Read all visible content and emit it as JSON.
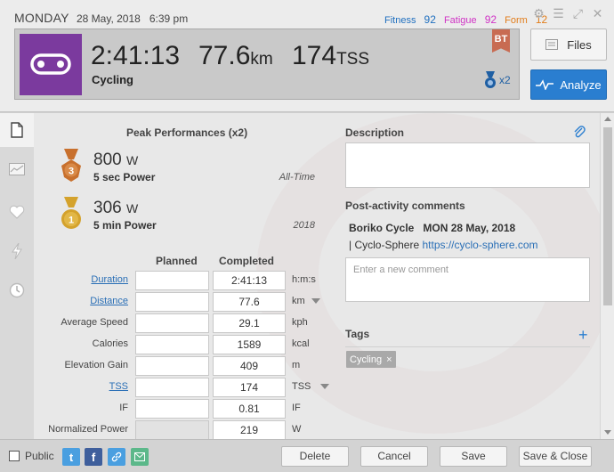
{
  "header": {
    "day": "MONDAY",
    "date": "28 May, 2018",
    "time": "6:39 pm",
    "fitness_label": "Fitness",
    "fitness_value": "92",
    "fatigue_label": "Fatigue",
    "fatigue_value": "92",
    "form_label": "Form",
    "form_value": "12",
    "window_icons": [
      "gear-icon",
      "menu-icon",
      "expand-icon",
      "close-icon"
    ]
  },
  "summary": {
    "sport_icon": "chain-link-icon",
    "sport_color": "#7b3a9e",
    "duration": "2:41:13",
    "distance_value": "77.6",
    "distance_unit": "km",
    "tss_value": "174",
    "tss_unit": "TSS",
    "sport": "Cycling",
    "badge": "BT",
    "medal_count": "x2"
  },
  "buttons": {
    "files": "Files",
    "analyze": "Analyze",
    "accent": "#2a7ed0"
  },
  "rail": [
    "document-icon",
    "chart-icon",
    "heart-icon",
    "lightning-icon",
    "clock-icon"
  ],
  "peak": {
    "title": "Peak Performances (x2)",
    "items": [
      {
        "rank": "3",
        "value": "800",
        "unit": "W",
        "label": "5 sec Power",
        "period": "All-Time"
      },
      {
        "rank": "1",
        "value": "306",
        "unit": "W",
        "label": "5 min Power",
        "period": "2018"
      }
    ]
  },
  "form": {
    "planned_header": "Planned",
    "completed_header": "Completed",
    "rows": [
      {
        "label": "Duration",
        "completed": "2:41:13",
        "unit": "h:m:s"
      },
      {
        "label": "Distance",
        "completed": "77.6",
        "unit": "km"
      },
      {
        "label": "Average Speed",
        "completed": "29.1",
        "unit": "kph"
      },
      {
        "label": "Calories",
        "completed": "1589",
        "unit": "kcal"
      },
      {
        "label": "Elevation Gain",
        "completed": "409",
        "unit": "m"
      },
      {
        "label": "TSS",
        "completed": "174",
        "unit": "TSS"
      },
      {
        "label": "IF",
        "completed": "0.81",
        "unit": "IF"
      },
      {
        "label": "Normalized Power",
        "completed": "219",
        "unit": "W"
      }
    ]
  },
  "description": {
    "title": "Description"
  },
  "comments": {
    "title": "Post-activity comments",
    "author": "Boriko Cycle",
    "when": "MON 28 May, 2018",
    "text_prefix": "| Cyclo-Sphere",
    "url": "https://cyclo-sphere.com",
    "placeholder": "Enter a new comment"
  },
  "tags": {
    "title": "Tags",
    "items": [
      "Cycling"
    ]
  },
  "footer": {
    "public_label": "Public",
    "share_icons": [
      "twitter-icon",
      "facebook-icon",
      "link-icon",
      "email-icon"
    ],
    "delete": "Delete",
    "cancel": "Cancel",
    "save": "Save",
    "save_close": "Save & Close"
  }
}
